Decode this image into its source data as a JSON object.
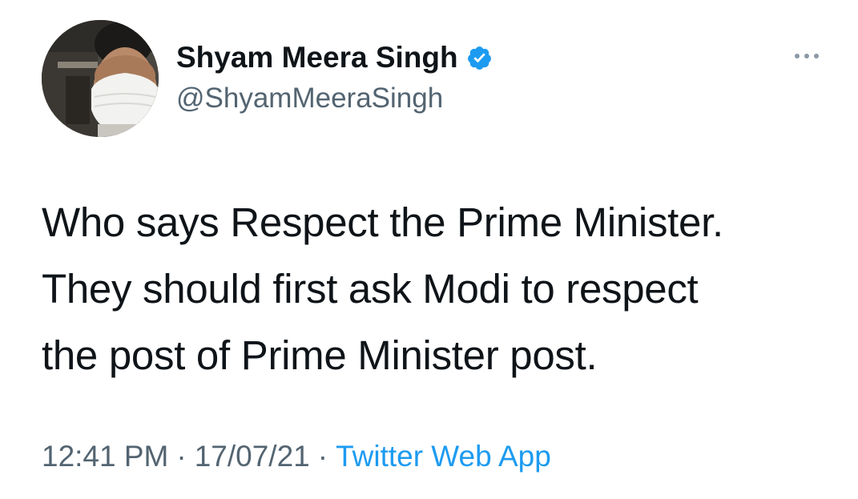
{
  "author": {
    "display_name": "Shyam Meera Singh",
    "handle": "@ShyamMeeraSingh",
    "verified": true
  },
  "tweet": {
    "lines": [
      "Who says Respect the Prime Minister.",
      "They should first ask Modi to respect",
      "the post of Prime Minister post."
    ]
  },
  "meta": {
    "time": "12:41 PM",
    "separator": "·",
    "date": "17/07/21",
    "source": "Twitter Web App"
  },
  "icons": {
    "verified": "verified-badge-icon",
    "more": "more-options-icon"
  },
  "colors": {
    "accent": "#1d9bf0",
    "text_primary": "#0f1419",
    "text_secondary": "#536471",
    "background": "#ffffff"
  }
}
